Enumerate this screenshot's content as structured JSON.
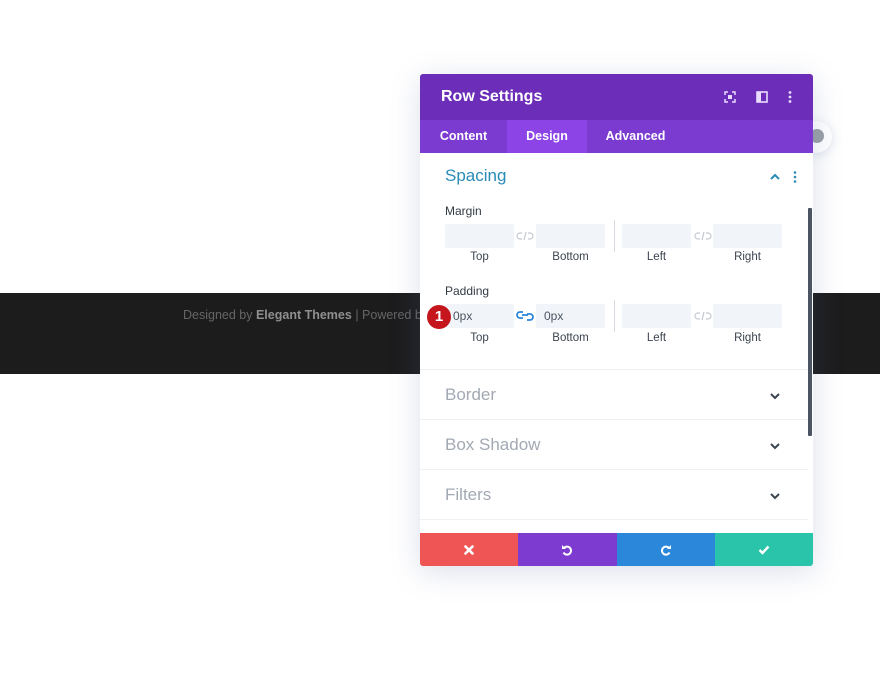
{
  "footer": {
    "prefix": "Designed by ",
    "brand": "Elegant Themes",
    "suffix": " | Powered by"
  },
  "modal": {
    "title": "Row Settings",
    "header_icons": [
      "fullscreen-icon",
      "split-view-icon",
      "more-options-icon"
    ],
    "tabs": [
      {
        "label": "Content",
        "active": false
      },
      {
        "label": "Design",
        "active": true
      },
      {
        "label": "Advanced",
        "active": false
      }
    ],
    "spacing": {
      "title": "Spacing",
      "expanded": true,
      "margin": {
        "label": "Margin",
        "fields": [
          {
            "label": "Top",
            "value": ""
          },
          {
            "label": "Bottom",
            "value": ""
          },
          {
            "label": "Left",
            "value": ""
          },
          {
            "label": "Right",
            "value": ""
          }
        ]
      },
      "padding": {
        "label": "Padding",
        "fields": [
          {
            "label": "Top",
            "value": "0px"
          },
          {
            "label": "Bottom",
            "value": "0px"
          },
          {
            "label": "Left",
            "value": ""
          },
          {
            "label": "Right",
            "value": ""
          }
        ],
        "top_bottom_linked": true
      }
    },
    "collapsed_sections": [
      {
        "title": "Border"
      },
      {
        "title": "Box Shadow"
      },
      {
        "title": "Filters"
      }
    ],
    "actions": [
      {
        "name": "cancel",
        "icon": "close-icon",
        "color": "#ef5555"
      },
      {
        "name": "undo",
        "icon": "undo-icon",
        "color": "#7d3bcf"
      },
      {
        "name": "redo",
        "icon": "redo-icon",
        "color": "#2b87da"
      },
      {
        "name": "save",
        "icon": "check-icon",
        "color": "#29c4a9"
      }
    ]
  },
  "annotation": {
    "badge_number": "1"
  },
  "colors": {
    "header": "#6c2eb9",
    "tabs": "#7b3bd1",
    "active_tab": "#8c44e6",
    "section_title": "#2a8bb7",
    "link_active": "#2b87da"
  }
}
